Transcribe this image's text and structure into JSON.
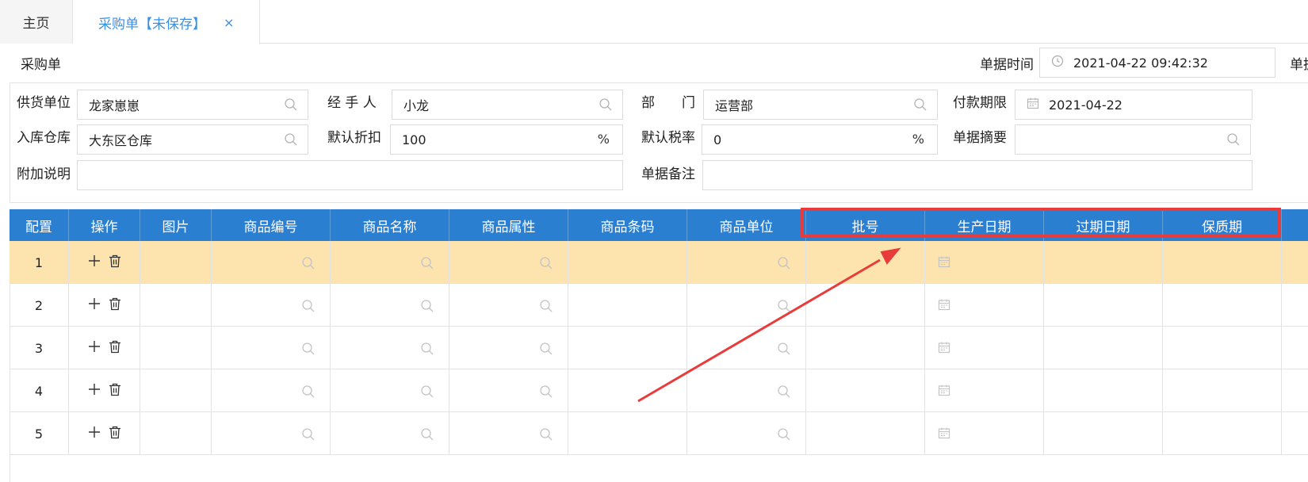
{
  "tabs": [
    {
      "label": "主页"
    },
    {
      "label": "采购单【未保存】",
      "close": "×"
    }
  ],
  "header": {
    "doc_title": "采购单",
    "date_label": "单据时间",
    "date_value": "2021-04-22 09:42:32",
    "date_label2": "单据"
  },
  "form": {
    "supplier": {
      "label": "供货单位",
      "value": "龙家崽崽"
    },
    "handler": {
      "label": "经 手 人",
      "value": "小龙"
    },
    "dept": {
      "label": "部　　门",
      "value": "运营部"
    },
    "pay_due": {
      "label": "付款期限",
      "value": "2021-04-22"
    },
    "warehouse": {
      "label": "入库仓库",
      "value": "大东区仓库"
    },
    "discount": {
      "label": "默认折扣",
      "value": "100",
      "unit": "%"
    },
    "tax": {
      "label": "默认税率",
      "value": "0",
      "unit": "%"
    },
    "summary": {
      "label": "单据摘要",
      "value": ""
    },
    "extra": {
      "label": "附加说明",
      "value": ""
    },
    "remark": {
      "label": "单据备注",
      "value": ""
    }
  },
  "grid": {
    "columns": [
      "配置",
      "操作",
      "图片",
      "商品编号",
      "商品名称",
      "商品属性",
      "商品条码",
      "商品单位",
      "批号",
      "生产日期",
      "过期日期",
      "保质期"
    ],
    "rows": [
      "1",
      "2",
      "3",
      "4",
      "5"
    ],
    "selected_row": "1"
  },
  "colors": {
    "accent": "#3d8fe0",
    "header_bg": "#2b7fd0",
    "selected_row": "#fde3ae",
    "annotation": "#e83c3c"
  }
}
